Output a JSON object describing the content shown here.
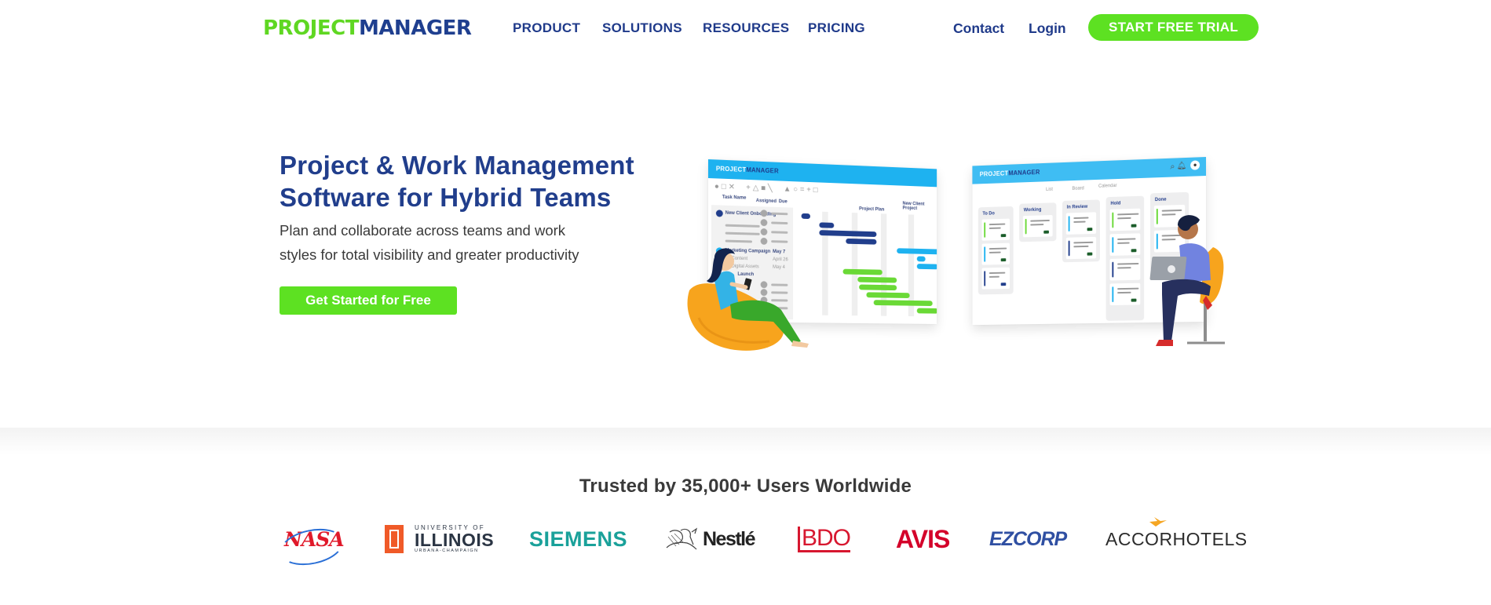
{
  "header": {
    "logo": {
      "part1": "PROJECT",
      "part2": "MANAGER"
    },
    "nav": [
      {
        "label": "PRODUCT"
      },
      {
        "label": "SOLUTIONS"
      },
      {
        "label": "RESOURCES"
      },
      {
        "label": "PRICING"
      }
    ],
    "contact_label": "Contact",
    "login_label": "Login",
    "trial_button_label": "START FREE TRIAL"
  },
  "hero": {
    "title_line1": "Project & Work Management",
    "title_line2": "Software for Hybrid Teams",
    "subtitle_line1": "Plan and collaborate across teams and work",
    "subtitle_line2": "styles for total visibility and greater productivity",
    "cta_label": "Get Started for Free",
    "gantt_mockup": {
      "logo_part1": "PROJECT",
      "logo_part2": "MANAGER",
      "col_task": "Task Name",
      "col_assigned": "Assigned",
      "col_due": "Due",
      "project_name": "New Client Project",
      "plan_label": "Project Plan",
      "tasks": [
        {
          "name": "New Client Onboarding",
          "due": ""
        },
        {
          "name": "Marketing Campaign",
          "due": "May 7"
        },
        {
          "name": "Content",
          "due": "April 26"
        },
        {
          "name": "Digital Assets",
          "due": "May 4"
        },
        {
          "name": "Launch",
          "due": ""
        }
      ]
    },
    "board_mockup": {
      "logo_part1": "PROJECT",
      "logo_part2": "MANAGER",
      "views": [
        "List",
        "Board",
        "Calendar"
      ],
      "columns": [
        {
          "title": "To Do"
        },
        {
          "title": "Working"
        },
        {
          "title": "In Review"
        },
        {
          "title": "Hold"
        },
        {
          "title": "Done"
        }
      ]
    }
  },
  "brand_colors": {
    "green": "#5de122",
    "navy": "#213e8c",
    "sky": "#1eb2f0"
  },
  "trust": {
    "title": "Trusted by 35,000+ Users Worldwide",
    "logos": [
      {
        "name": "NASA",
        "text": "NASA"
      },
      {
        "name": "University of Illinois",
        "top": "UNIVERSITY OF",
        "main": "ILLINOIS",
        "bottom": "URBANA-CHAMPAIGN"
      },
      {
        "name": "Siemens",
        "text": "SIEMENS"
      },
      {
        "name": "Nestle",
        "text": "Nestlé"
      },
      {
        "name": "BDO",
        "text": "BDO"
      },
      {
        "name": "Avis",
        "text": "AVIS"
      },
      {
        "name": "EZCorp",
        "text": "EZCORP"
      },
      {
        "name": "AccorHotels",
        "text": "ACCORHOTELS"
      }
    ]
  }
}
